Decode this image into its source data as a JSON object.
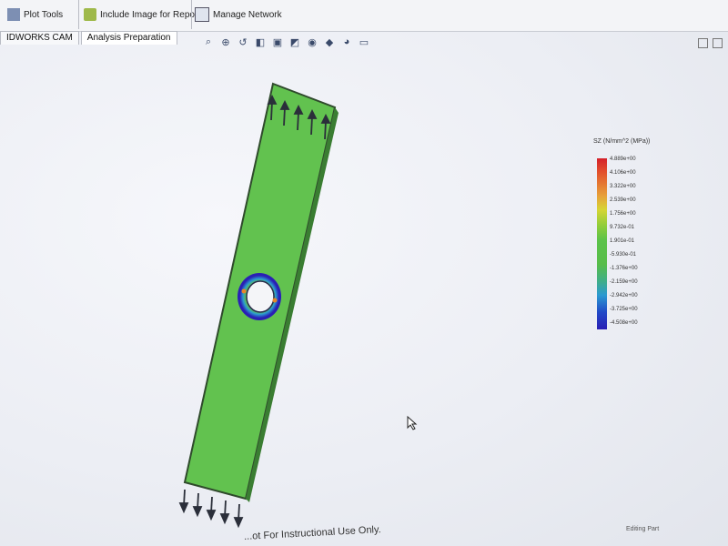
{
  "ribbon": {
    "plot_tools_label": "Plot Tools",
    "include_image_label": "Include Image for Report",
    "manage_network_label": "Manage Network"
  },
  "tabs": [
    {
      "label": "IDWORKS CAM"
    },
    {
      "label": "Analysis Preparation"
    }
  ],
  "hud_icons": [
    "zoom-to-fit-icon",
    "zoom-area-icon",
    "previous-view-icon",
    "section-view-icon",
    "view-orientation-icon",
    "display-style-icon",
    "hide-show-icon",
    "edit-appearance-icon",
    "scene-icon",
    "display-settings-icon"
  ],
  "legend": {
    "title": "SZ (N/mm^2 (MPa))",
    "labels": [
      "4.889e+00",
      "4.106e+00",
      "3.322e+00",
      "2.539e+00",
      "1.756e+00",
      "9.732e-01",
      "1.901e-01",
      "-5.930e-01",
      "-1.376e+00",
      "-2.159e+00",
      "-2.942e+00",
      "-3.725e+00",
      "-4.508e+00"
    ],
    "colors": {
      "max": "#d4202a",
      "mid": "#57bd4a",
      "min": "#2a1fb5"
    }
  },
  "footer_text": "...ot For Instructional Use Only.",
  "status": {
    "label": "Editing Part"
  }
}
